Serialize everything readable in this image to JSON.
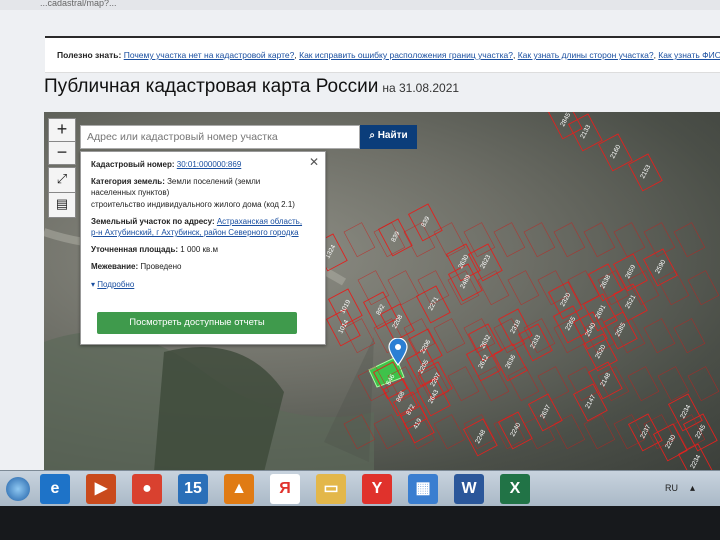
{
  "browser": {
    "url_fragment": "...cadastral/map?..."
  },
  "infobar": {
    "label": "Полезно знать:",
    "links": [
      "Почему участка нет на кадастровой карте?",
      "Как исправить ошибку расположения границ участка?",
      "Как узнать длины сторон участка?",
      "Как узнать ФИО собст"
    ]
  },
  "page": {
    "title": "Публичная кадастровая карта России",
    "date": "на 31.08.2021"
  },
  "map": {
    "zoom_in": "+",
    "zoom_out": "−",
    "search_placeholder": "Адрес или кадастровый номер участка",
    "search_button": "Найти",
    "popup": {
      "cad_label": "Кадастровый номер:",
      "cad_value": "30:01:000000:869",
      "cat_label": "Категория земель:",
      "cat_value_1": "Земли поселений (земли",
      "cat_value_2": "населенных пунктов)",
      "use_value": "строительство индивидуального жилого дома (код 2.1)",
      "addr_label": "Земельный участок по адресу:",
      "addr_value_1": "Астраханская область,",
      "addr_value_2": "р-н Ахтубинский, г Ахтубинск, район Северного городка",
      "area_label": "Уточненная площадь:",
      "area_value": "1 000 кв.м",
      "survey_label": "Межевание:",
      "survey_value": "Проведено",
      "more_link": "Подробно",
      "reports_button": "Посмотреть доступные отчеты"
    },
    "parcel_labels": [
      "1019",
      "1014",
      "892",
      "2208",
      "2271",
      "2489",
      "2623",
      "2630",
      "2206",
      "2205",
      "2207",
      "2643",
      "2632",
      "2612",
      "2318",
      "2333",
      "2636",
      "646",
      "868",
      "872",
      "419",
      "2240",
      "2248",
      "2637",
      "2147",
      "2148",
      "2320",
      "2265",
      "2638",
      "2659",
      "2590",
      "2691",
      "2540",
      "2585",
      "2521",
      "2520",
      "1324",
      "839",
      "839",
      "2133",
      "2845",
      "2160",
      "2153",
      "2234",
      "2237",
      "2230",
      "2245",
      "2234"
    ]
  },
  "taskbar": {
    "items": [
      {
        "icon": "ie-icon",
        "glyph": "e",
        "color": "#1e73c8"
      },
      {
        "icon": "media-player-icon",
        "glyph": "▶",
        "color": "#c94a1c"
      },
      {
        "icon": "chrome-icon",
        "glyph": "●",
        "color": "#d9412f"
      },
      {
        "icon": "badge-15-icon",
        "glyph": "15",
        "color": "#2a6fb8"
      },
      {
        "icon": "triangle-app-icon",
        "glyph": "▲",
        "color": "#e07b14"
      },
      {
        "icon": "yandex-icon",
        "glyph": "Я",
        "color": "#ffffff"
      },
      {
        "icon": "folder-icon",
        "glyph": "▭",
        "color": "#e3b74a"
      },
      {
        "icon": "yandex-browser-icon",
        "glyph": "Y",
        "color": "#e0322c"
      },
      {
        "icon": "explorer-icon",
        "glyph": "▦",
        "color": "#3a7ed0"
      },
      {
        "icon": "word-icon",
        "glyph": "W",
        "color": "#2b579a"
      },
      {
        "icon": "excel-icon",
        "glyph": "X",
        "color": "#217346"
      }
    ],
    "lang": "RU"
  }
}
